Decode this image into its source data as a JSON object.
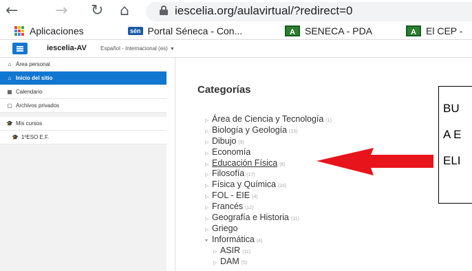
{
  "browser": {
    "back_glyph": "←",
    "forward_glyph": "→",
    "reload_glyph": "↻",
    "home_glyph": "⌂",
    "url": "iescelia.org/aulavirtual/?redirect=0"
  },
  "bookmarks": [
    {
      "label": "Aplicaciones",
      "icon": "apps-grid-icon"
    },
    {
      "label": "Portal Séneca - Con...",
      "icon": "seneca-icon",
      "badge": "sén"
    },
    {
      "label": "SENECA - PDA",
      "icon": "andalucia-icon",
      "badge": "A"
    },
    {
      "label": "El CEP -",
      "icon": "andalucia-icon",
      "badge": "A"
    }
  ],
  "header": {
    "site_name": "iescelia-AV",
    "language": "Español - Internacional (es)",
    "accent": "#1177d1"
  },
  "sidebar": {
    "items": [
      {
        "label": "Área personal",
        "icon": "dashboard-icon",
        "glyph": "⌂"
      },
      {
        "label": "Inicio del sitio",
        "icon": "home-icon",
        "glyph": "⌂"
      },
      {
        "label": "Calendario",
        "icon": "calendar-icon",
        "glyph": "▦"
      },
      {
        "label": "Archivos privados",
        "icon": "file-icon",
        "glyph": "▢"
      }
    ],
    "courses_header": {
      "label": "Mis cursos",
      "icon": "graduation-cap-icon",
      "glyph": "🎓"
    },
    "courses": [
      {
        "label": "1ºESO E.F.",
        "icon": "graduation-cap-icon",
        "glyph": "🎓"
      }
    ]
  },
  "categories": {
    "title": "Categorías",
    "items": [
      {
        "name": "Área de Ciencia y Tecnología",
        "count": "(1)"
      },
      {
        "name": "Biología y Geología",
        "count": "(16)"
      },
      {
        "name": "Dibujo",
        "count": "(9)"
      },
      {
        "name": "Economía",
        "count": ""
      },
      {
        "name": "Educación Física",
        "count": "(6)"
      },
      {
        "name": "Filosofía",
        "count": "(17)"
      },
      {
        "name": "Física y Química",
        "count": "(16)"
      },
      {
        "name": "FOL - EIE",
        "count": "(4)"
      },
      {
        "name": "Francés",
        "count": "(12)"
      },
      {
        "name": "Geografía e Historia",
        "count": "(11)"
      },
      {
        "name": "Griego",
        "count": ""
      },
      {
        "name": "Informática",
        "count": "(4)"
      },
      {
        "name": "ASIR",
        "count": "(11)"
      },
      {
        "name": "DAM",
        "count": "(5)"
      }
    ]
  },
  "annotation": {
    "lines": [
      "BU",
      "A E",
      "ELI"
    ],
    "arrow_color": "#e8141b"
  }
}
